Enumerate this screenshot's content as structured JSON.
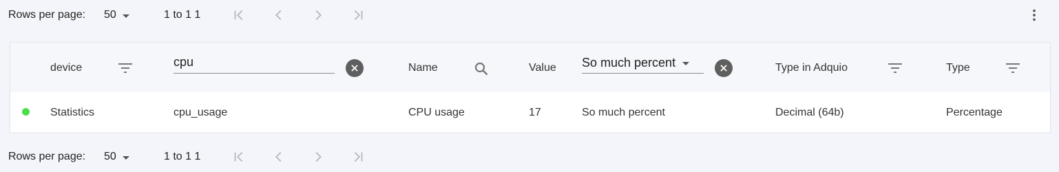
{
  "colors": {
    "background": "#f4f5fa",
    "status_ok": "#4cdd4c",
    "icon": "#777777",
    "clear_button": "#5f5f5f"
  },
  "pager_top": {
    "rows_per_page_label": "Rows per page:",
    "rows_per_page_value": "50",
    "range_text": "1 to 1 1"
  },
  "pager_bottom": {
    "rows_per_page_label": "Rows per page:",
    "rows_per_page_value": "50",
    "range_text": "1 to 1 1"
  },
  "table": {
    "headers": {
      "device": "device",
      "name": "Name",
      "value": "Value",
      "type_in_adquio": "Type in Adquio",
      "type": "Type"
    },
    "filters": {
      "cpu_filter_value": "cpu",
      "unit_filter_value": "So much percent"
    },
    "rows": [
      {
        "device": "Statistics",
        "id": "cpu_usage",
        "name": "CPU usage",
        "value": "17",
        "unit": "So much percent",
        "type_in_adquio": "Decimal (64b)",
        "type": "Percentage"
      }
    ]
  }
}
